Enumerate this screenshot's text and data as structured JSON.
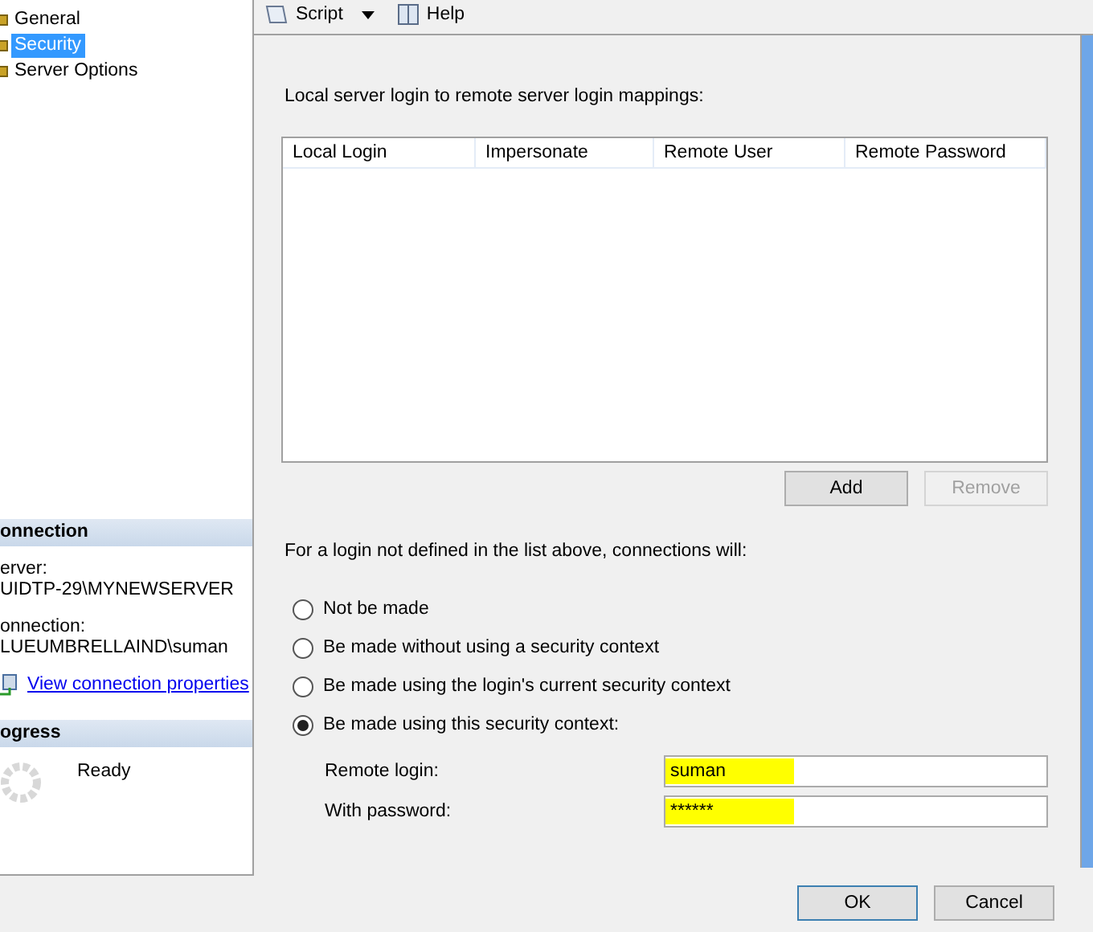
{
  "toolbar": {
    "items": [
      {
        "label": "Script",
        "kind": "script"
      },
      {
        "label": "Help",
        "kind": "help"
      }
    ]
  },
  "sidebar": {
    "items": [
      {
        "label": "General",
        "selected": false
      },
      {
        "label": "Security",
        "selected": true
      },
      {
        "label": "Server Options",
        "selected": false
      }
    ]
  },
  "connection": {
    "title": "onnection",
    "server_label": "erver:",
    "server": "UIDTP-29\\MYNEWSERVER",
    "connection_label": "onnection:",
    "connection": "LUEUMBRELLAIND\\suman",
    "link": "View connection properties"
  },
  "progress": {
    "title": "ogress",
    "status": "Ready"
  },
  "mappings": {
    "label": "Local server login to remote server login mappings:",
    "columns": [
      "Local Login",
      "Impersonate",
      "Remote User",
      "Remote Password"
    ],
    "buttons": [
      {
        "label": "Add",
        "disabled": false
      },
      {
        "label": "Remove",
        "disabled": true
      }
    ]
  },
  "undefined_logins": {
    "label": "For a login not defined in the list above, connections will:",
    "options": [
      {
        "label": "Not be made",
        "selected": false
      },
      {
        "label": "Be made without using a security context",
        "selected": false
      },
      {
        "label": "Be made using the login's current security context",
        "selected": false
      },
      {
        "label": "Be made using this security context:",
        "selected": true
      }
    ],
    "fields": [
      {
        "label": "Remote login:",
        "value": "suman",
        "highlighted": true
      },
      {
        "label": "With password:",
        "value": "******",
        "highlighted": true
      }
    ]
  },
  "footer": {
    "buttons": [
      "OK",
      "Cancel"
    ]
  }
}
